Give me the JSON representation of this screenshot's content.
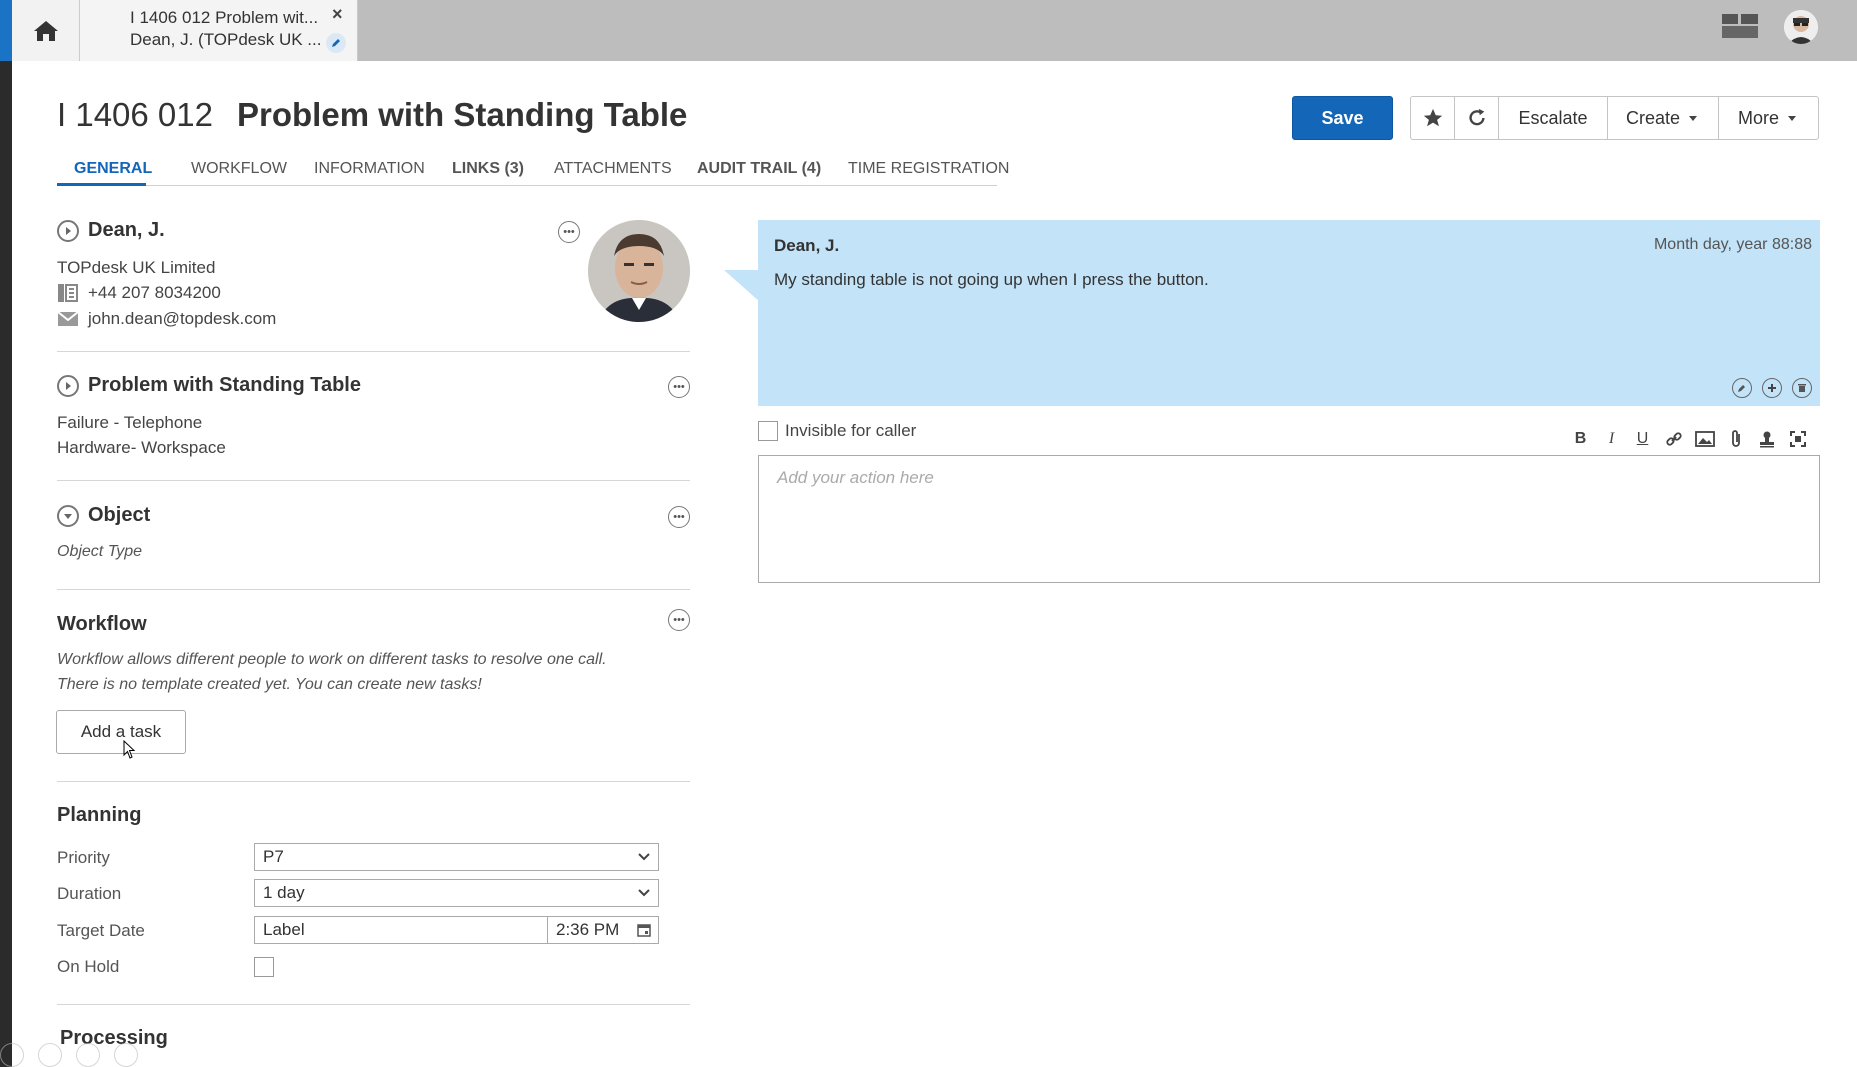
{
  "tab": {
    "line1": "I 1406 012 Problem wit...",
    "line2": "Dean, J.  (TOPdesk UK ...",
    "close": "×"
  },
  "header": {
    "number": "I 1406 012",
    "title": "Problem with Standing Table",
    "save_label": "Save",
    "escalate_label": "Escalate",
    "create_label": "Create",
    "more_label": "More"
  },
  "tabs": [
    {
      "label": "GENERAL"
    },
    {
      "label": "WORKFLOW"
    },
    {
      "label": "INFORMATION"
    },
    {
      "label": "LINKS (3)"
    },
    {
      "label": "ATTACHMENTS"
    },
    {
      "label": "AUDIT TRAIL (4)"
    },
    {
      "label": "TIME REGISTRATION"
    }
  ],
  "caller": {
    "name": "Dean, J.",
    "company": "TOPdesk UK Limited",
    "phone": "+44 207 8034200",
    "email": "john.dean@topdesk.com"
  },
  "problem": {
    "title": "Problem with Standing Table",
    "line1": "Failure - Telephone",
    "line2": "Hardware- Workspace"
  },
  "object": {
    "title": "Object",
    "type": "Object Type"
  },
  "workflow": {
    "title": "Workflow",
    "desc1": "Workflow allows different people to work on different tasks to resolve one call.",
    "desc2": "There is no template created yet. You can create new tasks!",
    "add_task_label": "Add a task"
  },
  "planning": {
    "title": "Planning",
    "priority_label": "Priority",
    "priority_value": "P7",
    "duration_label": "Duration",
    "duration_value": "1 day",
    "target_label": "Target Date",
    "target_date": "Label",
    "target_time": "2:36 PM",
    "onhold_label": "On Hold"
  },
  "processing": {
    "title": "Processing"
  },
  "message": {
    "author": "Dean, J.",
    "date": "Month day, year 88:88",
    "text": "My standing table is not going up when I press the button."
  },
  "action": {
    "invisible_label": "Invisible for caller",
    "placeholder": "Add your action here"
  },
  "colors": {
    "accent": "#1466b8",
    "bubble": "#c3e3f8"
  }
}
